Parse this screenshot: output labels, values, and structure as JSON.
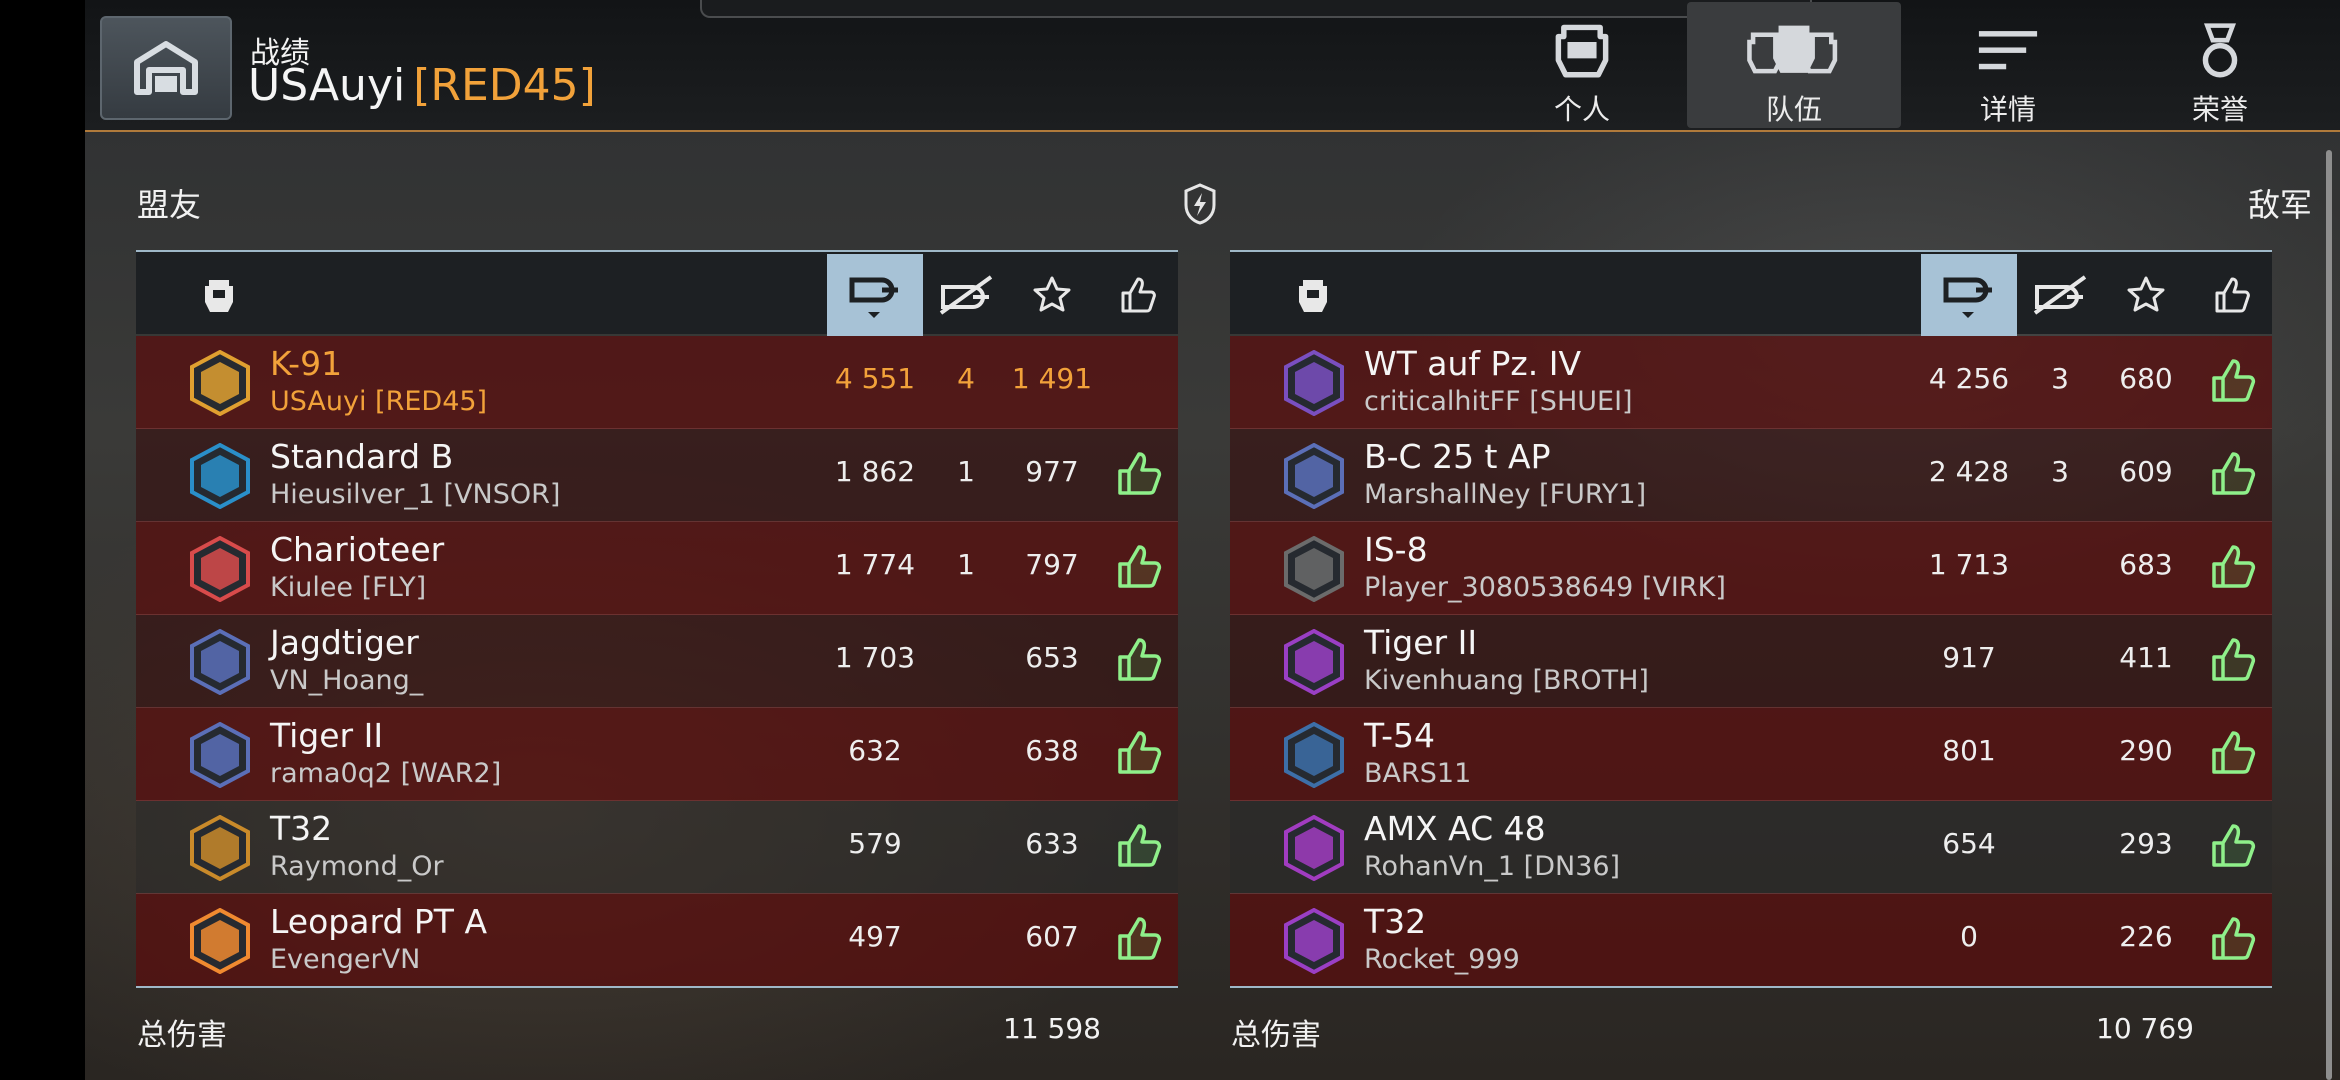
{
  "header": {
    "subtitle": "战绩",
    "player": "USAuyi",
    "clan": "[RED45]"
  },
  "nav": [
    {
      "label": "个人",
      "icon": "personal-helmet-icon"
    },
    {
      "label": "队伍",
      "icon": "team-helmets-icon",
      "active": true
    },
    {
      "label": "详情",
      "icon": "details-list-icon"
    },
    {
      "label": "荣誉",
      "icon": "medal-icon"
    }
  ],
  "allies_label": "盟友",
  "enemies_label": "敌军",
  "columns": [
    "tank-icon",
    "damage-icon",
    "kills-icon",
    "experience-star-icon",
    "like-icon"
  ],
  "allies": {
    "total_label": "总伤害",
    "total": "11 598",
    "rows": [
      {
        "tank": "K-91",
        "player": "USAuyi [RED45]",
        "damage": "4 551",
        "kills": "4",
        "exp": "1 491",
        "liked": false,
        "self": true,
        "badge": "#e0a030"
      },
      {
        "tank": "Standard B",
        "player": "Hieusilver_1 [VNSOR]",
        "damage": "1 862",
        "kills": "1",
        "exp": "977",
        "liked": true,
        "badge": "#2a8fc9"
      },
      {
        "tank": "Charioteer",
        "player": "Kiulee [FLY]",
        "damage": "1 774",
        "kills": "1",
        "exp": "797",
        "liked": true,
        "badge": "#d84b4b"
      },
      {
        "tank": "Jagdtiger",
        "player": "VN_Hoang_",
        "damage": "1 703",
        "kills": "",
        "exp": "653",
        "liked": true,
        "badge": "#5b6fb8"
      },
      {
        "tank": "Tiger II",
        "player": "rama0q2 [WAR2]",
        "damage": "632",
        "kills": "",
        "exp": "638",
        "liked": true,
        "badge": "#5b6fb8"
      },
      {
        "tank": "T32",
        "player": "Raymond_Or",
        "damage": "579",
        "kills": "",
        "exp": "633",
        "liked": true,
        "badge": "#c98a2a"
      },
      {
        "tank": "Leopard PT A",
        "player": "EvengerVN",
        "damage": "497",
        "kills": "",
        "exp": "607",
        "liked": true,
        "badge": "#f08a30"
      }
    ]
  },
  "enemies": {
    "total_label": "总伤害",
    "total": "10 769",
    "rows": [
      {
        "tank": "WT auf Pz. IV",
        "player": "criticalhitFF [SHUEI]",
        "damage": "4 256",
        "kills": "3",
        "exp": "680",
        "liked": true,
        "badge": "#7a4fc0"
      },
      {
        "tank": "B-C 25 t AP",
        "player": "MarshallNey [FURY1]",
        "damage": "2 428",
        "kills": "3",
        "exp": "609",
        "liked": true,
        "badge": "#5b6fb8"
      },
      {
        "tank": "IS-8",
        "player": "Player_3080538649 [VIRK]",
        "damage": "1 713",
        "kills": "",
        "exp": "683",
        "liked": true,
        "badge": "#6b6b6b"
      },
      {
        "tank": "Tiger II",
        "player": "Kivenhuang [BROTH]",
        "damage": "917",
        "kills": "",
        "exp": "411",
        "liked": true,
        "badge": "#9a3fc4"
      },
      {
        "tank": "T-54",
        "player": "BARS11",
        "damage": "801",
        "kills": "",
        "exp": "290",
        "liked": true,
        "badge": "#3d6fa8"
      },
      {
        "tank": "AMX AC 48",
        "player": "RohanVn_1 [DN36]",
        "damage": "654",
        "kills": "",
        "exp": "293",
        "liked": true,
        "badge": "#a13cc0"
      },
      {
        "tank": "T32",
        "player": "Rocket_999",
        "damage": "0",
        "kills": "",
        "exp": "226",
        "liked": true,
        "badge": "#9a3fc4"
      }
    ]
  }
}
